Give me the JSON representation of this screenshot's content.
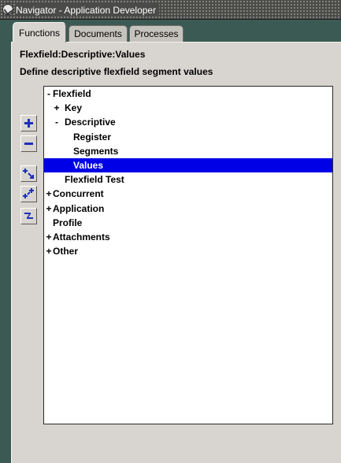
{
  "window": {
    "title": "Navigator - Application Developer",
    "icon": "oracle-app-icon"
  },
  "tabs": [
    {
      "label": "Functions",
      "active": true
    },
    {
      "label": "Documents",
      "active": false
    },
    {
      "label": "Processes",
      "active": false
    }
  ],
  "page": {
    "path_label": "Flexfield:Descriptive:Values",
    "instruction": "Define descriptive flexfield segment values"
  },
  "side_buttons": [
    {
      "name": "expand",
      "icon": "expand-plus-icon"
    },
    {
      "name": "collapse",
      "icon": "collapse-minus-icon"
    },
    {
      "name": "expand-branch",
      "icon": "expand-branch-icon"
    },
    {
      "name": "expand-all",
      "icon": "expand-all-icon"
    },
    {
      "name": "collapse-all",
      "icon": "collapse-all-icon"
    }
  ],
  "tree": {
    "nodes": [
      {
        "label": "Flexfield",
        "marker": "-",
        "level": 0,
        "selected": false
      },
      {
        "label": "Key",
        "marker": "+",
        "level": 1,
        "selected": false
      },
      {
        "label": "Descriptive",
        "marker": "-",
        "level": 1,
        "selected": false
      },
      {
        "label": "Register",
        "marker": "",
        "level": 2,
        "selected": false
      },
      {
        "label": "Segments",
        "marker": "",
        "level": 2,
        "selected": false
      },
      {
        "label": "Values",
        "marker": "",
        "level": 2,
        "selected": true
      },
      {
        "label": "Flexfield Test",
        "marker": "",
        "level": 1,
        "selected": false
      },
      {
        "label": "Concurrent",
        "marker": "+",
        "level": 0,
        "selected": false
      },
      {
        "label": "Application",
        "marker": "+",
        "level": 0,
        "selected": false
      },
      {
        "label": "Profile",
        "marker": "",
        "level": 0,
        "selected": false
      },
      {
        "label": "Attachments",
        "marker": "+",
        "level": 0,
        "selected": false
      },
      {
        "label": "Other",
        "marker": "+",
        "level": 0,
        "selected": false
      }
    ]
  },
  "colors": {
    "selection": "#0000e6",
    "panel": "#d8d5d0",
    "background": "#3c5a54"
  }
}
